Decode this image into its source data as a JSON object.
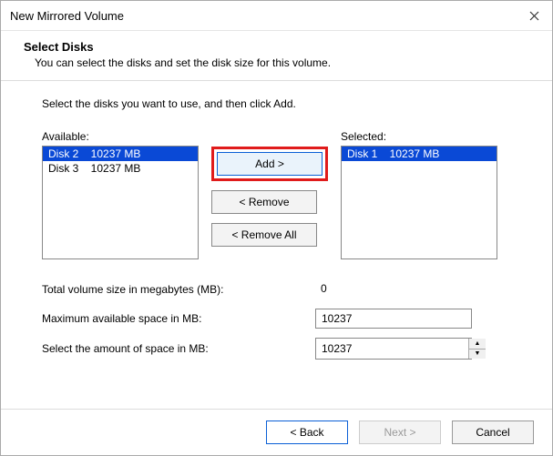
{
  "window": {
    "title": "New Mirrored Volume"
  },
  "header": {
    "title": "Select Disks",
    "subtitle": "You can select the disks and set the disk size for this volume."
  },
  "instructions": "Select the disks you want to use, and then click Add.",
  "labels": {
    "available": "Available:",
    "selected": "Selected:"
  },
  "available": [
    {
      "text": "Disk 2    10237 MB",
      "selected": true
    },
    {
      "text": "Disk 3    10237 MB",
      "selected": false
    }
  ],
  "selected_list": [
    {
      "text": "Disk 1    10237 MB",
      "selected": true
    }
  ],
  "buttons": {
    "add": "Add >",
    "remove": "< Remove",
    "remove_all": "< Remove All",
    "back": "< Back",
    "next": "Next >",
    "cancel": "Cancel"
  },
  "fields": {
    "total_label": "Total volume size in megabytes (MB):",
    "total_value": "0",
    "max_label": "Maximum available space in MB:",
    "max_value": "10237",
    "amount_label": "Select the amount of space in MB:",
    "amount_value": "10237"
  }
}
